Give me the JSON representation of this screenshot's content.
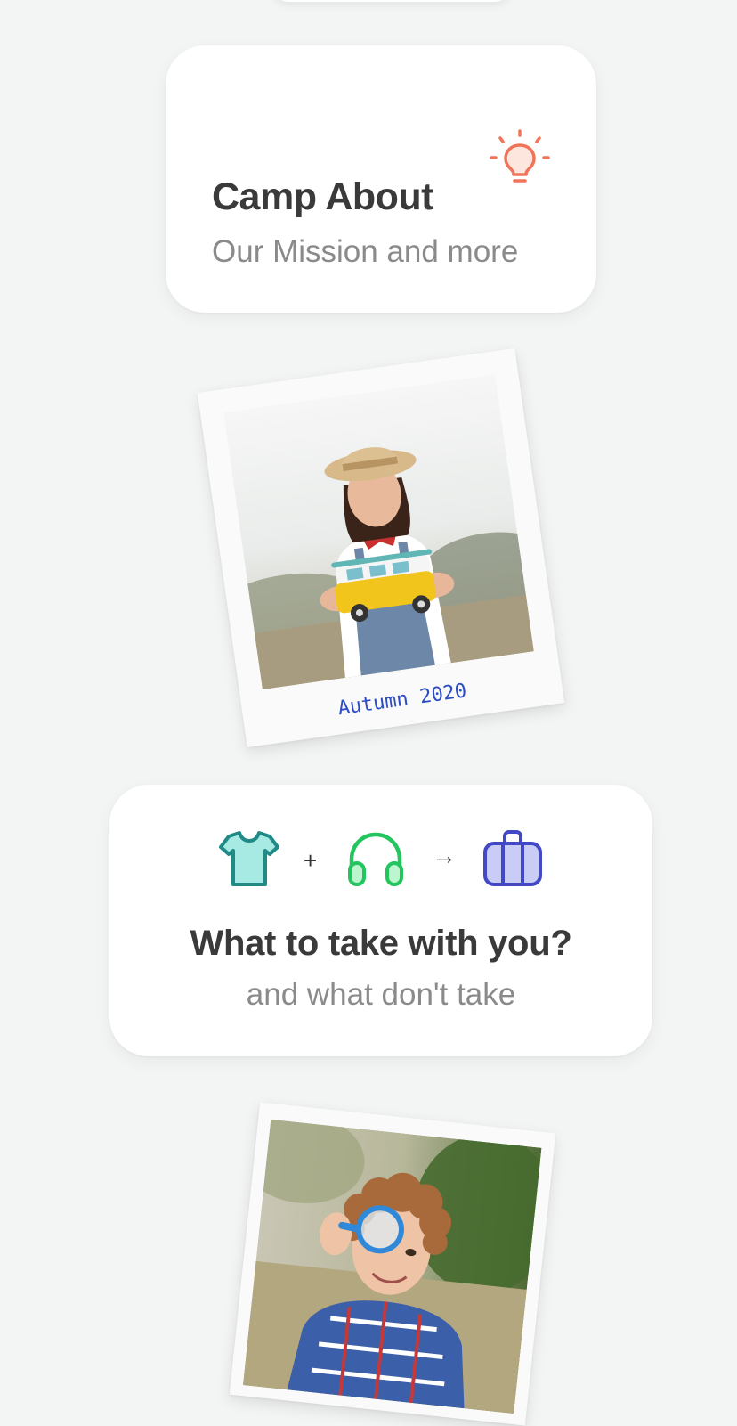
{
  "about_card": {
    "title": "Camp About",
    "subtitle": "Our Mission and more",
    "icon": "lightbulb-icon",
    "icon_color": "#f0735a"
  },
  "photo_card_1": {
    "caption": "Autumn 2020",
    "caption_color": "#2b4cc4",
    "image": "child-holding-toy-van-photo"
  },
  "pack_card": {
    "title": "What to take with you?",
    "subtitle": "and what don't take",
    "icons": [
      "tshirt-icon",
      "headphones-icon",
      "suitcase-icon"
    ],
    "operators": [
      "+",
      "→"
    ],
    "colors": {
      "tshirt": "#1f8a86",
      "headphones": "#22c55e",
      "suitcase": "#4348c4"
    }
  },
  "photo_card_2": {
    "image": "child-with-magnifying-glass-photo"
  }
}
